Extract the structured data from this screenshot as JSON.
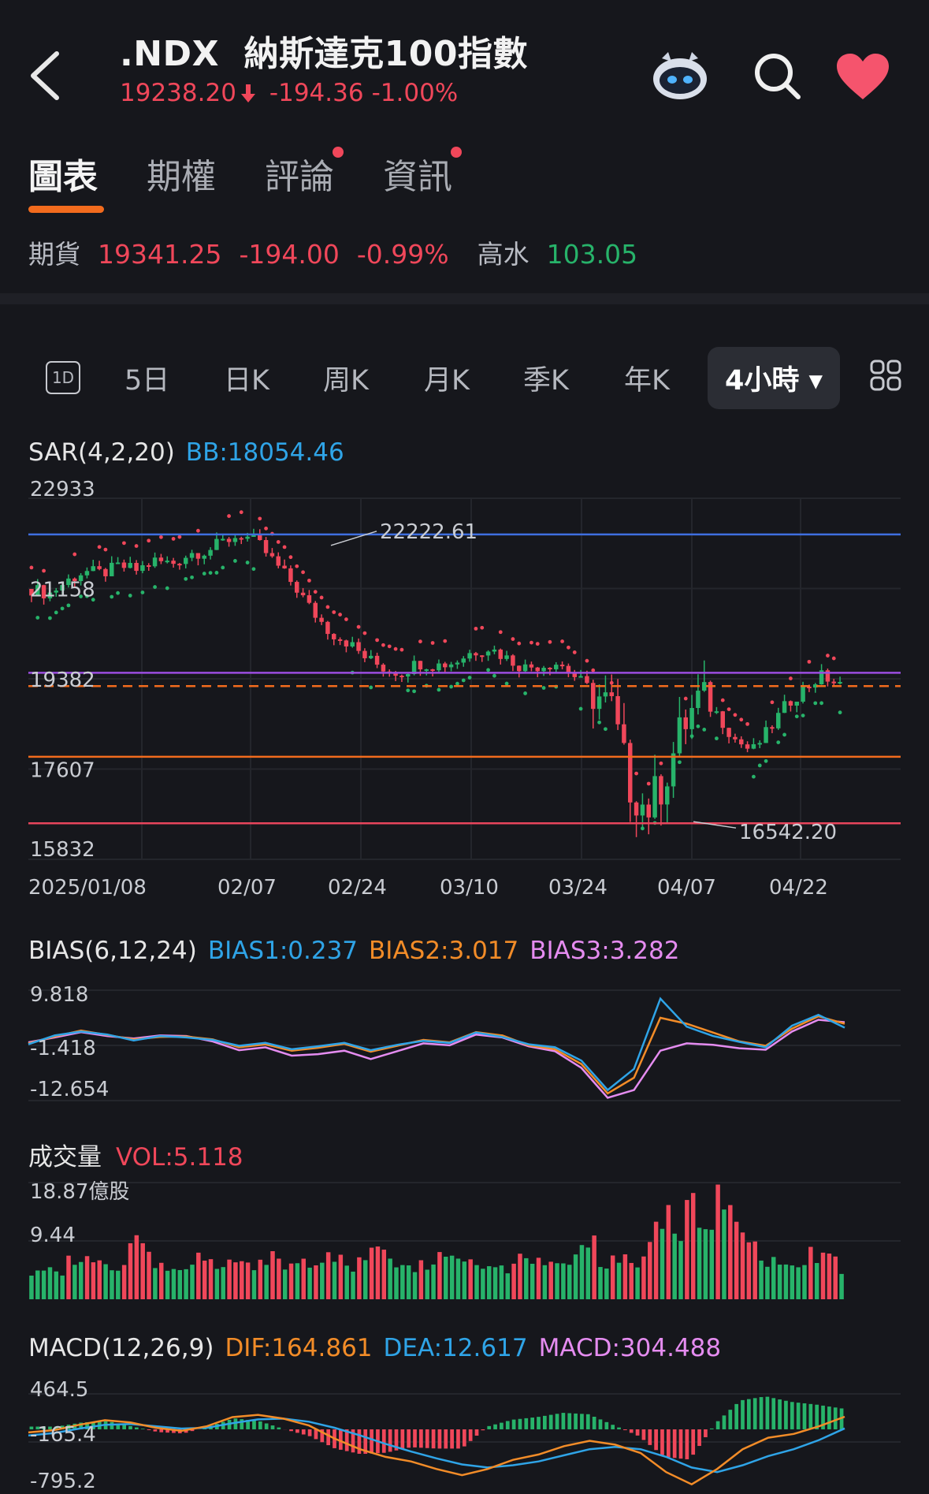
{
  "header": {
    "symbol": ".NDX",
    "name": "納斯達克100指數",
    "price": "19238.20",
    "change": "-194.36",
    "change_pct": "-1.00%",
    "icons": [
      "robot-icon",
      "search-icon",
      "heart-icon"
    ]
  },
  "tabs": [
    {
      "label": "圖表",
      "active": true,
      "dot": false
    },
    {
      "label": "期權",
      "active": false,
      "dot": false
    },
    {
      "label": "評論",
      "active": false,
      "dot": true
    },
    {
      "label": "資訊",
      "active": false,
      "dot": true
    }
  ],
  "futures": {
    "label": "期貨",
    "price": "19341.25",
    "change": "-194.00",
    "change_pct": "-0.99%",
    "premium_label": "高水",
    "premium": "103.05"
  },
  "periods": [
    {
      "label": "1D",
      "style": "boxed"
    },
    {
      "label": "5日"
    },
    {
      "label": "日K"
    },
    {
      "label": "周K"
    },
    {
      "label": "月K"
    },
    {
      "label": "季K"
    },
    {
      "label": "年K"
    },
    {
      "label": "4小時 ▾",
      "selected": true
    }
  ],
  "colors": {
    "up": "#27b36a",
    "down": "#f0475a",
    "accent": "#f26b1d",
    "bias1": "#2fa4e7",
    "bias2": "#f28c28",
    "bias3": "#e58cf0"
  },
  "main_panel": {
    "indicator": "SAR(4,2,20)",
    "bb": "BB:18054.46",
    "y_labels": [
      "22933",
      "21158",
      "19382",
      "17607",
      "15832"
    ],
    "x_labels": [
      "2025/01/08",
      "02/07",
      "02/24",
      "03/10",
      "03/24",
      "04/07",
      "04/22"
    ],
    "high_label": "22222.61",
    "low_label": "16542.20"
  },
  "bias_panel": {
    "title": "BIAS(6,12,24)",
    "bias1": "BIAS1:0.237",
    "bias2": "BIAS2:3.017",
    "bias3": "BIAS3:3.282",
    "y_labels": [
      "9.818",
      "-1.418",
      "-12.654"
    ]
  },
  "vol_panel": {
    "title": "成交量",
    "vol": "VOL:5.118",
    "y_labels": [
      "18.87億股",
      "9.44"
    ]
  },
  "macd_panel": {
    "title": "MACD(12,26,9)",
    "dif": "DIF:164.861",
    "dea": "DEA:12.617",
    "macd": "MACD:304.488",
    "y_labels": [
      "464.5",
      "-165.4",
      "-795.2"
    ]
  },
  "chart_data": {
    "type": "candlestick",
    "x_ticks": [
      "2025/01/08",
      "02/07",
      "02/24",
      "03/10",
      "03/24",
      "04/07",
      "04/22"
    ],
    "ylim": [
      15832,
      22933
    ],
    "y_ticks": [
      22933,
      21158,
      19382,
      17607,
      15832
    ],
    "annotations": [
      {
        "label": "22222.61",
        "value": 22222.61
      },
      {
        "label": "16542.20",
        "value": 16542.2
      }
    ],
    "hlines": [
      {
        "value": 22222.61,
        "color": "#3f6fe0"
      },
      {
        "value": 19500,
        "color": "#9b4de0"
      },
      {
        "value": 19238.2,
        "color": "#f26b1d",
        "dashed": true
      },
      {
        "value": 17850,
        "color": "#f26b1d"
      },
      {
        "value": 16542.2,
        "color": "#e8455c"
      }
    ],
    "close_path": [
      21150,
      21050,
      21300,
      21500,
      21450,
      21600,
      21520,
      21700,
      21650,
      21850,
      21900,
      22100,
      22222,
      22000,
      21600,
      21200,
      20700,
      20300,
      20100,
      19800,
      19600,
      19500,
      19700,
      19650,
      19700,
      19900,
      20000,
      19800,
      19600,
      19650,
      19700,
      19400,
      19100,
      18800,
      17300,
      16800,
      17400,
      18400,
      19000,
      18700,
      18200,
      17950,
      18400,
      18900,
      19200,
      19450,
      19238
    ],
    "bias": {
      "ylim": [
        -12.654,
        9.818
      ],
      "series": [
        {
          "name": "BIAS1",
          "values": [
            -1.2,
            0.6,
            1.4,
            0.8,
            -0.4,
            0.5,
            0.2,
            -0.3,
            -1.5,
            -0.9,
            -2.2,
            -1.6,
            -0.9,
            -2.4,
            -1.3,
            -0.5,
            -0.9,
            1.2,
            0.3,
            -1.2,
            -1.8,
            -4.5,
            -10.5,
            -6.2,
            8.1,
            2.4,
            0.5,
            -0.7,
            -1.8,
            2.6,
            4.8,
            2.2
          ]
        },
        {
          "name": "BIAS2",
          "values": [
            -1.0,
            0.4,
            1.6,
            0.7,
            -0.2,
            0.3,
            0.4,
            -0.2,
            -1.8,
            -1.2,
            -2.5,
            -1.9,
            -1.1,
            -2.7,
            -1.5,
            -0.3,
            -0.8,
            1.3,
            0.6,
            -1.4,
            -2.2,
            -5.2,
            -11.2,
            -8.0,
            4.2,
            3.0,
            1.2,
            -0.6,
            -1.5,
            2.0,
            4.5,
            3.0
          ]
        },
        {
          "name": "BIAS3",
          "values": [
            -0.8,
            0.2,
            1.3,
            0.5,
            0.0,
            0.6,
            0.5,
            -0.6,
            -2.4,
            -1.8,
            -3.5,
            -3.2,
            -2.5,
            -4.2,
            -2.6,
            -1.0,
            -1.4,
            0.8,
            0.2,
            -1.6,
            -2.6,
            -6.0,
            -12.1,
            -10.5,
            -2.5,
            -1.0,
            -1.3,
            -2.0,
            -2.3,
            1.4,
            3.8,
            3.3
          ]
        }
      ]
    },
    "volume": {
      "ylim": [
        0,
        18.87
      ],
      "unit": "億股",
      "bars": [
        5.1,
        6.3,
        4.8,
        7.2,
        5.5,
        5.9,
        4.4,
        9.8,
        6.1,
        5.2,
        5.0,
        6.6,
        5.4,
        5.8,
        6.0,
        5.3,
        7.1,
        5.6,
        6.4,
        5.2,
        7.8,
        6.0,
        5.9,
        8.3,
        6.7,
        6.2,
        5.5,
        6.9,
        7.4,
        6.8,
        5.7,
        6.1,
        5.3,
        8.1,
        5.8,
        6.4,
        7.0,
        11.2,
        6.5,
        6.3,
        5.9,
        6.0,
        14.5,
        10.9,
        16.0,
        12.1,
        18.87,
        11.4,
        8.9,
        6.7,
        7.5,
        6.2,
        8.0,
        7.2,
        5.1
      ]
    },
    "macd": {
      "ylim": [
        -795.2,
        464.5
      ],
      "dif": [
        -40,
        -10,
        60,
        120,
        90,
        20,
        -20,
        40,
        160,
        190,
        140,
        50,
        -120,
        -260,
        -360,
        -420,
        -520,
        -600,
        -520,
        -400,
        -330,
        -220,
        -150,
        -200,
        -310,
        -560,
        -720,
        -520,
        -260,
        -110,
        -60,
        40,
        164.861
      ],
      "dea": [
        -80,
        -50,
        10,
        60,
        70,
        40,
        10,
        20,
        80,
        130,
        140,
        100,
        20,
        -80,
        -190,
        -290,
        -380,
        -460,
        -500,
        -470,
        -420,
        -340,
        -260,
        -230,
        -260,
        -360,
        -500,
        -560,
        -470,
        -350,
        -260,
        -140,
        12.617
      ],
      "hist": [
        40,
        40,
        100,
        120,
        40,
        -40,
        -60,
        40,
        160,
        120,
        0,
        -100,
        -280,
        -360,
        -340,
        -260,
        -280,
        -280,
        40,
        140,
        180,
        240,
        220,
        60,
        -100,
        -400,
        -440,
        80,
        420,
        480,
        400,
        360,
        304.488
      ]
    }
  }
}
